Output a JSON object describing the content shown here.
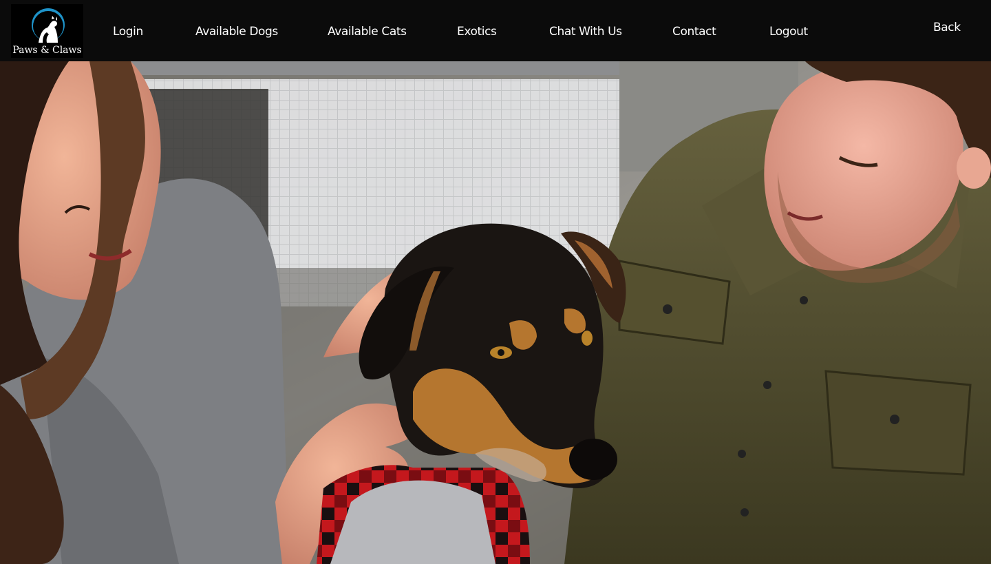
{
  "brand": {
    "name": "Paws & Claws"
  },
  "nav": {
    "items": [
      {
        "label": "Login"
      },
      {
        "label": "Available Dogs"
      },
      {
        "label": "Available Cats"
      },
      {
        "label": "Exotics"
      },
      {
        "label": "Chat With Us"
      },
      {
        "label": "Contact"
      },
      {
        "label": "Logout"
      }
    ],
    "back_label": "Back"
  },
  "hero": {
    "icon": "hero-photo",
    "colors": {
      "shirt_left": "#7d7f83",
      "shirt_right": "#4e4a2a",
      "dog_black": "#1a1512",
      "dog_tan": "#b5762f",
      "bandana": "#c4181d"
    }
  }
}
